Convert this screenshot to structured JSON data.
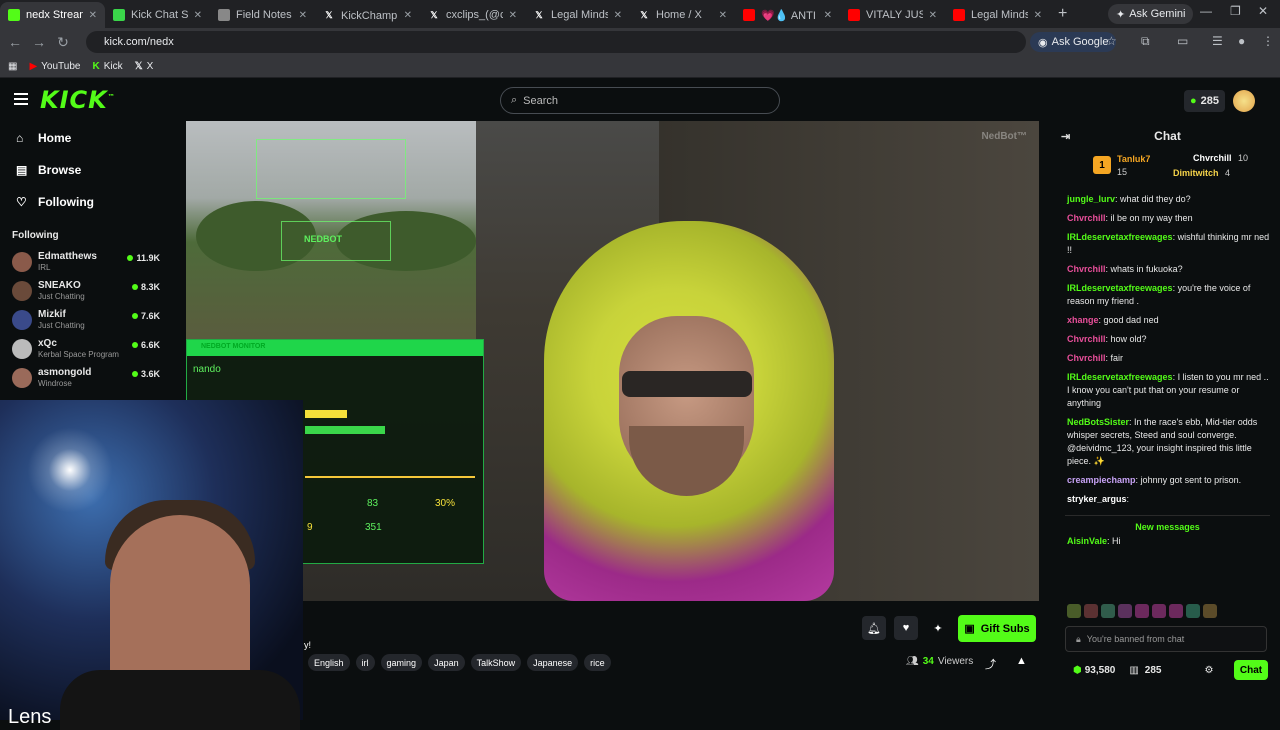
{
  "browser": {
    "tabs": [
      {
        "label": "nedx Stream",
        "icon": "kick-favicon",
        "active": true
      },
      {
        "label": "Kick Chat Searc",
        "icon": "chat-favicon"
      },
      {
        "label": "Field Notes — I",
        "icon": "globe-favicon"
      },
      {
        "label": "KickChamp 🍿 o",
        "icon": "x-favicon"
      },
      {
        "label": "cxclips_(@cx_cl",
        "icon": "x-favicon"
      },
      {
        "label": "Legal Mindset (@",
        "icon": "x-favicon"
      },
      {
        "label": "Home / X",
        "icon": "x-favicon"
      },
      {
        "label": "💗💧 ANTI SE",
        "icon": "youtube-favicon"
      },
      {
        "label": "VITALY JUST GO",
        "icon": "youtube-favicon"
      },
      {
        "label": "Legal Mindset",
        "icon": "youtube-favicon"
      }
    ],
    "new_tab": "+",
    "gemini": "Ask Gemini",
    "url": "kick.com/nedx",
    "ask_google": "Ask Google",
    "bookmarks": [
      {
        "label": "YouTube",
        "icon": "youtube-icon"
      },
      {
        "label": "Kick",
        "icon": "kick-icon"
      },
      {
        "label": "X",
        "icon": "x-icon"
      }
    ]
  },
  "header": {
    "logo": "KICK",
    "search_placeholder": "Search",
    "points": "285"
  },
  "sidebar": {
    "nav": [
      {
        "label": "Home",
        "icon": "home-icon"
      },
      {
        "label": "Browse",
        "icon": "browse-icon"
      },
      {
        "label": "Following",
        "icon": "heart-icon"
      }
    ],
    "following_title": "Following",
    "following": [
      {
        "name": "Edmatthews",
        "game": "IRL",
        "viewers": "11.9K",
        "color": "#8a5a4a"
      },
      {
        "name": "SNEAKO",
        "game": "Just Chatting",
        "viewers": "8.3K",
        "color": "#6a4a3a"
      },
      {
        "name": "Mizkif",
        "game": "Just Chatting",
        "viewers": "7.6K",
        "color": "#3a4a8a"
      },
      {
        "name": "xQc",
        "game": "Kerbal Space Program",
        "viewers": "6.6K",
        "color": "#bbbbbb"
      },
      {
        "name": "asmongold",
        "game": "Windrose",
        "viewers": "3.6K",
        "color": "#9a6a5a"
      }
    ]
  },
  "video": {
    "watermark": "NedBot™",
    "hud_label": "NEDBOT",
    "monitor_title": "NEDBOT MONITOR",
    "monitor_name": "nando",
    "monitor_val1": "83",
    "monitor_val2": "30%",
    "monitor_val3": "351",
    "monitor_val4": "9",
    "webcam_text": "Lens",
    "fragment": "y!"
  },
  "stream": {
    "gift_label": "Gift Subs",
    "tags": [
      "English",
      "irl",
      "gaming",
      "Japan",
      "TalkShow",
      "Japanese",
      "rice"
    ],
    "viewers_count": "34",
    "viewers_label": "Viewers"
  },
  "chat": {
    "title": "Chat",
    "leaderboard": [
      {
        "name": "Tanluk7",
        "count": "15",
        "color": "#f5a623"
      },
      {
        "name": "Chvrchill",
        "count": "10",
        "color": "#ffffff"
      },
      {
        "name": "Dimitwitch",
        "count": "4",
        "color": "#f5d34a"
      }
    ],
    "messages": [
      {
        "user": "jungle_lurv",
        "text": "what did they do?",
        "color": "#53fc18"
      },
      {
        "user": "Chvrchill",
        "text": "il be on my way then",
        "color": "#e84f9a"
      },
      {
        "user": "IRLdeservetaxfreewages",
        "text": "wishful thinking mr ned !!",
        "color": "#53fc18"
      },
      {
        "user": "Chvrchill",
        "text": "whats in fukuoka?",
        "color": "#e84f9a"
      },
      {
        "user": "IRLdeservetaxfreewages",
        "text": "you're the voice of reason my friend .",
        "color": "#53fc18"
      },
      {
        "user": "xhange",
        "text": "good dad ned",
        "color": "#e84f9a"
      },
      {
        "user": "Chvrchill",
        "text": "how old?",
        "color": "#e84f9a"
      },
      {
        "user": "Chvrchill",
        "text": "fair",
        "color": "#e84f9a"
      },
      {
        "user": "IRLdeservetaxfreewages",
        "text": "I listen to you mr ned .. I know you can't put that on your resume or anything",
        "color": "#53fc18"
      },
      {
        "user": "NedBotsSister",
        "text": "In the race's ebb, Mid-tier odds whisper secrets, Steed and soul converge. @deividmc_123, your insight inspired this little piece. ✨",
        "color": "#53fc18"
      },
      {
        "user": "creampiechamp",
        "text": "johnny got sent to prison.",
        "color": "#c7a2f5"
      },
      {
        "user": "stryker_argus",
        "text": "",
        "color": "#ffffff"
      }
    ],
    "new_messages": "New messages",
    "last_message": {
      "user": "AisinVale",
      "text": "Hi",
      "color": "#53fc18"
    },
    "banned": "You're banned from chat",
    "balance": "93,580",
    "points": "285",
    "send": "Chat"
  }
}
